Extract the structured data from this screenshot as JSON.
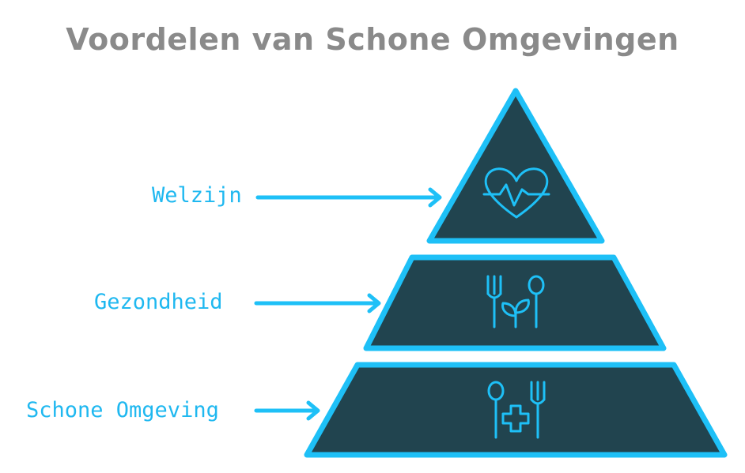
{
  "title": "Voordelen van Schone Omgevingen",
  "levels": [
    {
      "label": "Welzijn",
      "icon": "heartbeat-icon"
    },
    {
      "label": "Gezondheid",
      "icon": "fork-sprout-spoon-icon"
    },
    {
      "label": "Schone Omgeving",
      "icon": "spoon-cross-fork-icon"
    }
  ],
  "colors": {
    "fill": "#21444f",
    "stroke": "#1ec0f7",
    "arrow": "#1ec0f7",
    "label": "#1fb8f0",
    "title": "#8a8a8a"
  }
}
